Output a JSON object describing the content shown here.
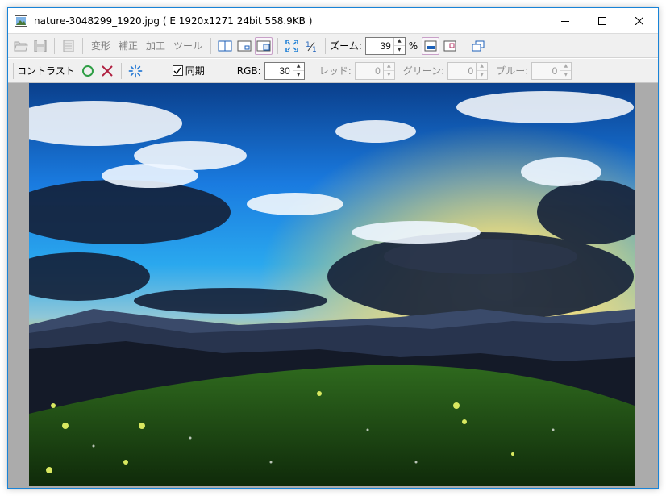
{
  "window": {
    "title": "nature-3048299_1920.jpg ( E  1920x1271  24bit  558.9KB )",
    "accent": "#1883d7"
  },
  "toolbar": {
    "menus": [
      "変形",
      "補正",
      "加工",
      "ツール"
    ],
    "zoom_label": "ズーム:",
    "zoom_value": "39",
    "zoom_unit": "%",
    "icons": [
      "open-folder-icon",
      "save-icon",
      "document-icon",
      "split-view-icon",
      "minimize-view-icon",
      "fit-window-icon",
      "fullscreen-icon",
      "actual-size-icon",
      "window-fit-icon",
      "window-resize-icon",
      "new-window-icon"
    ]
  },
  "adjust": {
    "contrast_label": "コントラスト",
    "sync_label": "同期",
    "sync_checked": true,
    "rgb_label": "RGB:",
    "rgb_value": "30",
    "red_label": "レッド:",
    "red_value": "0",
    "green_label": "グリーン:",
    "green_value": "0",
    "blue_label": "ブルー:",
    "blue_value": "0",
    "ok_color": "#2e9e45",
    "cancel_color": "#b02040",
    "preview_color": "#2a7bd4"
  },
  "image": {
    "description_icon": "landscape-photo"
  }
}
